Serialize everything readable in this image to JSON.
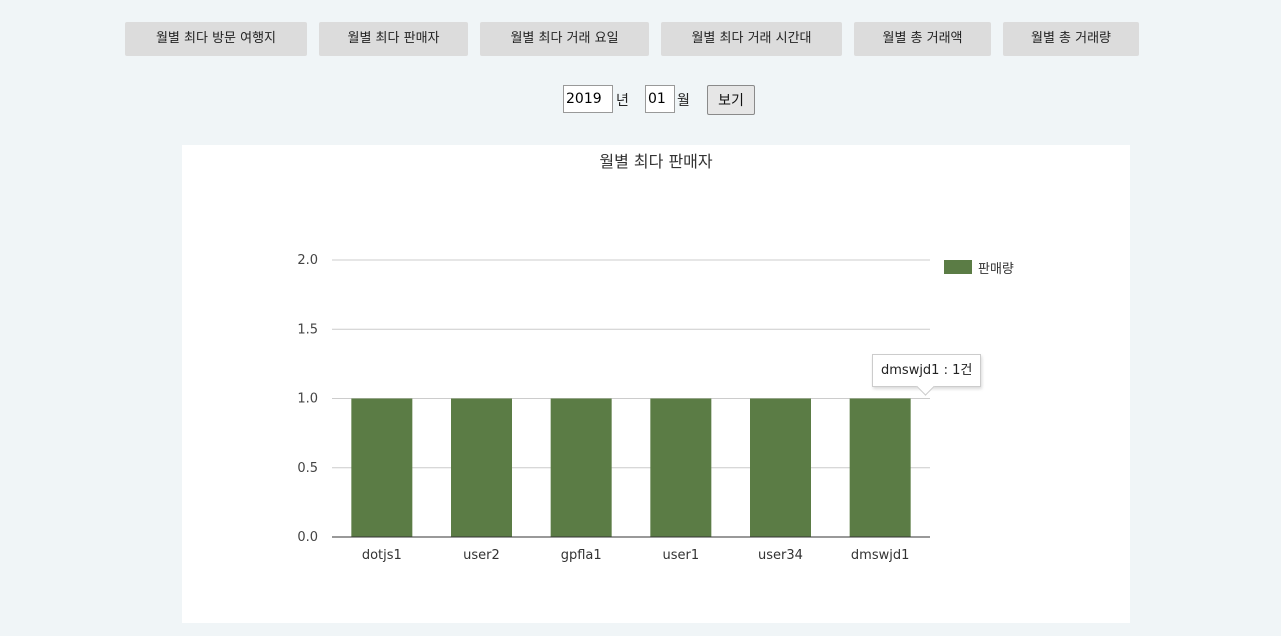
{
  "tabs": [
    {
      "label": "월별 최다 방문 여행지"
    },
    {
      "label": "월별 최다 판매자"
    },
    {
      "label": "월별 최다 거래 요일"
    },
    {
      "label": "월별 최다 거래 시간대"
    },
    {
      "label": "월별 총 거래액"
    },
    {
      "label": "월별 총 거래량"
    }
  ],
  "date_filter": {
    "year_value": "2019",
    "year_suffix": "년",
    "month_value": "01",
    "month_suffix": "월",
    "view_button_label": "보기"
  },
  "tooltip": {
    "text": "dmswjd1 : 1건"
  },
  "chart_data": {
    "type": "bar",
    "title": "월별 최다 판매자",
    "categories": [
      "dotjs1",
      "user2",
      "gpfla1",
      "user1",
      "user34",
      "dmswjd1"
    ],
    "series": [
      {
        "name": "판매량",
        "values": [
          1,
          1,
          1,
          1,
          1,
          1
        ],
        "color": "#5b7c45"
      }
    ],
    "ylim": [
      0,
      2
    ],
    "yticks": [
      "0.0",
      "0.5",
      "1.0",
      "1.5",
      "2.0"
    ],
    "grid": true,
    "legend_position": "right",
    "xlabel": "",
    "ylabel": ""
  },
  "colors": {
    "bar": "#5b7c45",
    "background": "#f0f5f7",
    "tab_background": "#dcdcdc"
  }
}
